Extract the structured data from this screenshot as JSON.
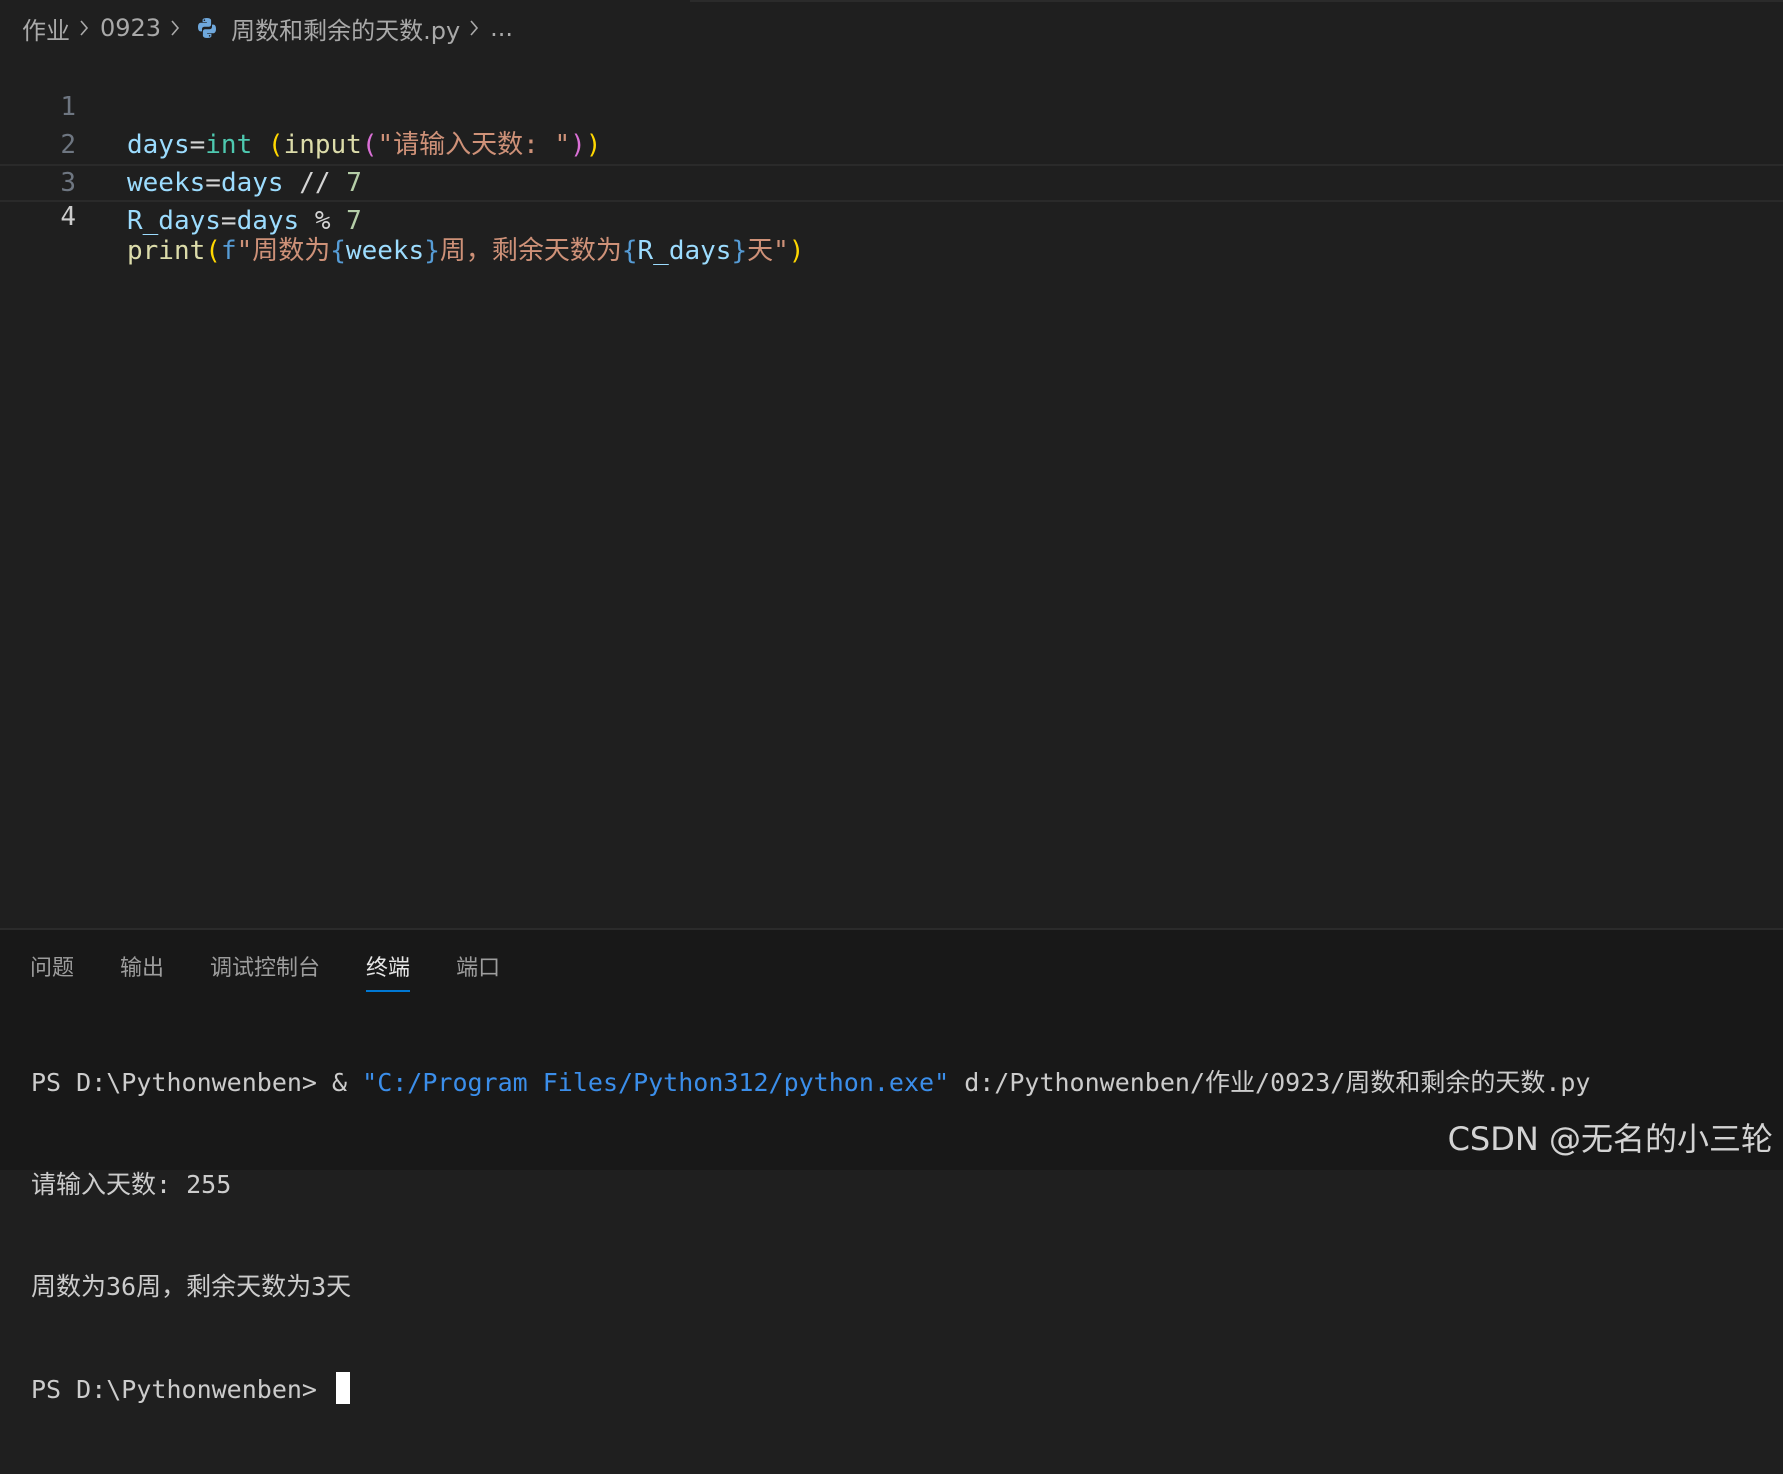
{
  "breadcrumb": {
    "folder1": "作业",
    "folder2": "0923",
    "file": "周数和剩余的天数.py",
    "more": "..."
  },
  "editor": {
    "lines": [
      {
        "number": "1",
        "code": "days=int (input(\"请输入天数: \"))"
      },
      {
        "number": "2",
        "code": "weeks=days // 7"
      },
      {
        "number": "3",
        "code": "R_days=days % 7"
      },
      {
        "number": "4",
        "code": "print(f\"周数为{weeks}周，剩余天数为{R_days}天\")"
      }
    ],
    "current_line": "4"
  },
  "panel": {
    "tabs": [
      "问题",
      "输出",
      "调试控制台",
      "终端",
      "端口"
    ],
    "active_tab": "终端"
  },
  "terminal": {
    "line1_prompt": "PS D:\\Pythonwenben> & ",
    "line1_exe": "\"C:/Program Files/Python312/python.exe\"",
    "line1_path": " d:/Pythonwenben/作业/0923/周数和剩余的天数.py",
    "line2": "请输入天数: 255",
    "line3": "周数为36周，剩余天数为3天",
    "line4_prompt": "PS D:\\Pythonwenben> "
  },
  "watermark": "CSDN @无名的小三轮",
  "colors": {
    "background": "#1f1f1f",
    "panel_background": "#181818",
    "active_tab_underline": "#0078d4"
  }
}
